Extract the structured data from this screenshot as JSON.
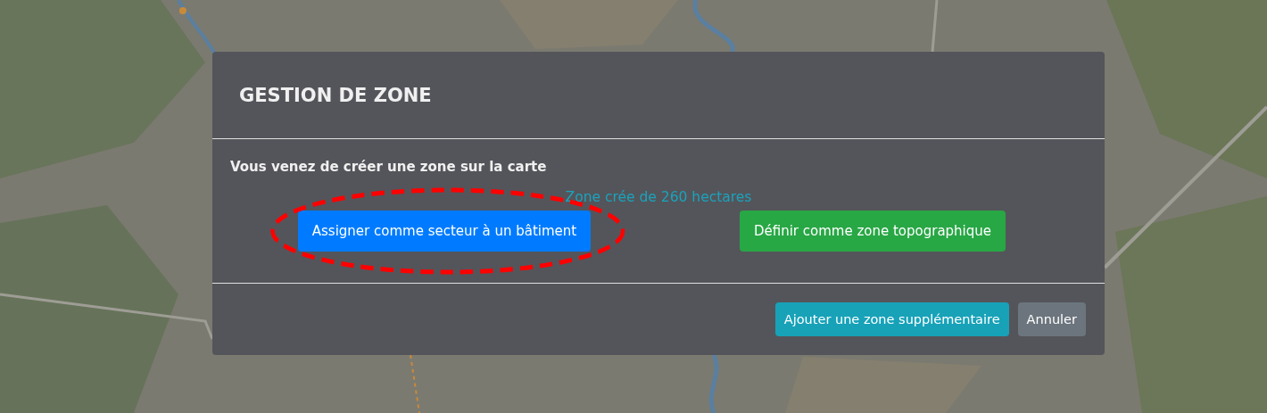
{
  "dialog": {
    "title": "GESTION DE ZONE",
    "message": "Vous venez de créer une zone sur la carte",
    "info": "Zone crée de 260 hectares",
    "actions": [
      {
        "label": "Assigner comme secteur à un bâtiment",
        "kind": "primary",
        "circled": true
      },
      {
        "label": "Définir comme zone topographique",
        "kind": "success",
        "circled": false
      }
    ],
    "footer_buttons": [
      {
        "label": "Ajouter une zone supplémentaire",
        "kind": "info"
      },
      {
        "label": "Annuler",
        "kind": "secondary"
      }
    ]
  }
}
